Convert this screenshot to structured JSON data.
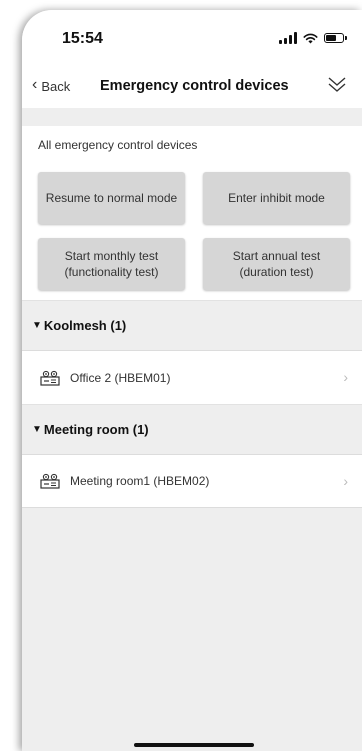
{
  "status_bar": {
    "time": "15:54",
    "icons": [
      "signal-icon",
      "wifi-icon",
      "battery-icon"
    ]
  },
  "nav": {
    "back_label": "Back",
    "title": "Emergency control devices",
    "collapse_icon": "double-chevron-down-icon"
  },
  "panel": {
    "label": "All emergency control devices",
    "buttons": {
      "resume": "Resume to normal mode",
      "inhibit": "Enter inhibit mode",
      "monthly": "Start monthly test\n(functionality test)",
      "annual": "Start annual test\n(duration test)"
    }
  },
  "groups": [
    {
      "title": "Koolmesh (1)",
      "devices": [
        {
          "label": "Office 2 (HBEM01)",
          "icon": "emergency-device-icon"
        }
      ]
    },
    {
      "title": "Meeting room (1)",
      "devices": [
        {
          "label": "Meeting room1 (HBEM02)",
          "icon": "emergency-device-icon"
        }
      ]
    }
  ],
  "colors": {
    "background": "#eeeeee",
    "button": "#d6d6d6",
    "text": "#222222"
  }
}
